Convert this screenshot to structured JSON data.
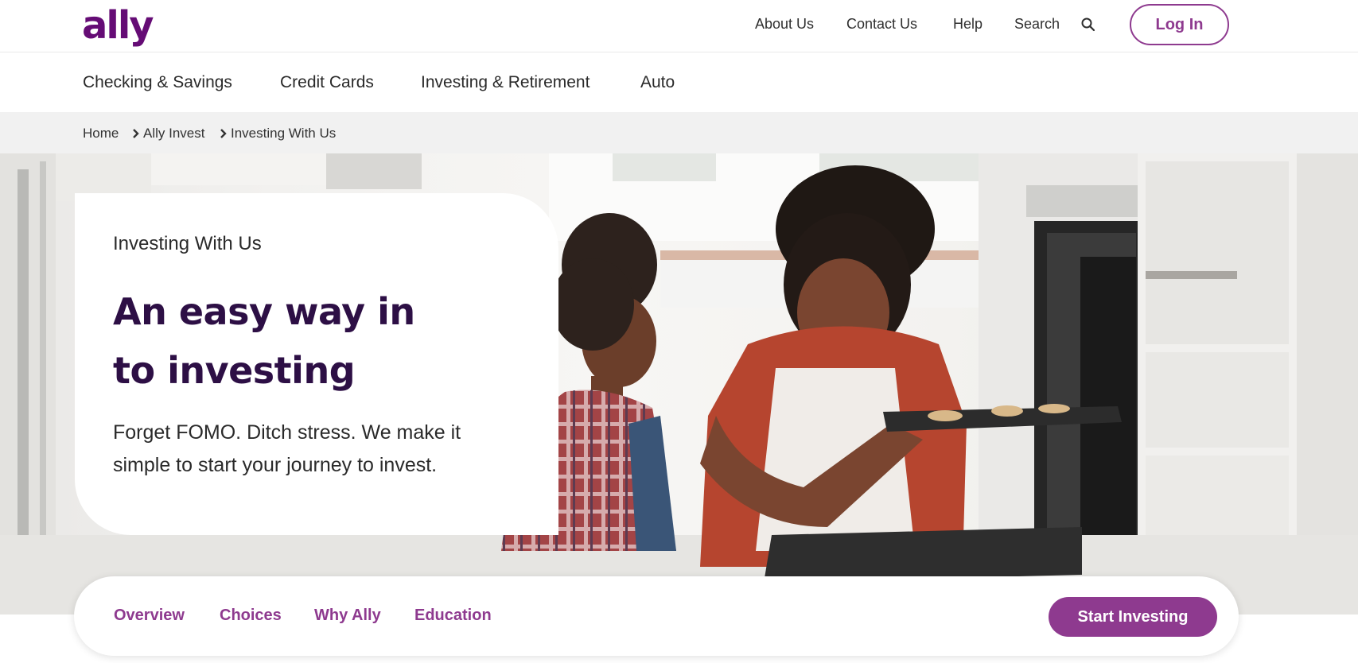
{
  "header": {
    "logo_text": "ally",
    "brand_color": "#650c75",
    "utility_links": [
      "About Us",
      "Contact Us",
      "Help",
      "Search"
    ],
    "search_icon": "search-icon",
    "login_label": "Log In"
  },
  "main_nav": {
    "items": [
      "Checking & Savings",
      "Credit Cards",
      "Investing & Retirement",
      "Auto"
    ]
  },
  "breadcrumb": {
    "items": [
      "Home",
      "Ally Invest",
      "Investing With Us"
    ],
    "separator_icon": "chevron-right-icon"
  },
  "hero": {
    "eyebrow": "Investing With Us",
    "headline_line1": "An easy way in",
    "headline_line2": "to investing",
    "subtext_line1": "Forget FOMO. Ditch stress. We make it",
    "subtext_line2": "simple to start your journey to invest.",
    "headline_color": "#2d0f45"
  },
  "section_tabs": {
    "tabs": [
      "Overview",
      "Choices",
      "Why Ally",
      "Education"
    ],
    "cta_label": "Start Investing",
    "accent_color": "#8e3a8f"
  }
}
